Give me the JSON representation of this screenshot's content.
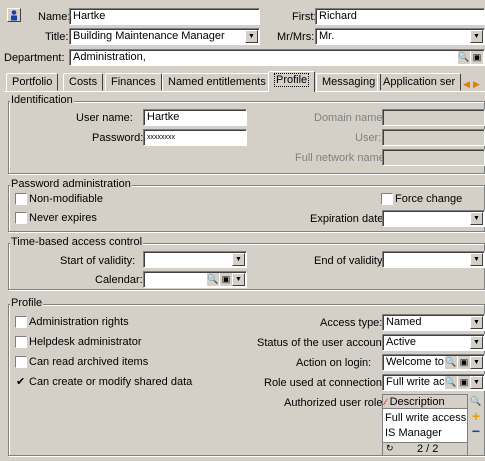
{
  "header": {
    "name_label": "Name:",
    "name_value": "Hartke",
    "first_label": "First:",
    "first_value": "Richard",
    "title_label": "Title:",
    "title_value": "Building Maintenance Manager",
    "mrmrs_label": "Mr/Mrs:",
    "mrmrs_value": "Mr.",
    "department_label": "Department:",
    "department_value": "Administration,"
  },
  "tabs": [
    {
      "label": "Portfolio"
    },
    {
      "label": "Costs"
    },
    {
      "label": "Finances"
    },
    {
      "label": "Named entitlements"
    },
    {
      "label": "Profile"
    },
    {
      "label": "Messaging"
    },
    {
      "label": "Application ser"
    }
  ],
  "identification": {
    "title": "Identification",
    "username_label": "User name:",
    "username_value": "Hartke",
    "password_label": "Password:",
    "password_value": "xxxxxxxx",
    "domain_label": "Domain name:",
    "user_label": "User:",
    "fullnetwork_label": "Full network name:"
  },
  "password_admin": {
    "title": "Password administration",
    "non_modifiable": "Non-modifiable",
    "force_change": "Force change",
    "never_expires": "Never expires",
    "expiration_label": "Expiration date:"
  },
  "time_access": {
    "title": "Time-based access control",
    "start_label": "Start of validity:",
    "end_label": "End of validity:",
    "calendar_label": "Calendar:"
  },
  "profile": {
    "title": "Profile",
    "admin_rights": "Administration rights",
    "helpdesk_admin": "Helpdesk administrator",
    "read_archived": "Can read archived items",
    "create_shared": "Can create or modify shared data",
    "check_mark": "✔",
    "access_type_label": "Access type:",
    "access_type_value": "Named",
    "status_label": "Status of the user account:",
    "status_value": "Active",
    "action_login_label": "Action on login:",
    "action_login_value": "Welcome to A",
    "role_label": "Role used at connection:",
    "role_value": "Full write acc",
    "authorized_roles_label": "Authorized user roles:",
    "roles_header": "Description",
    "roles": [
      "Full write access",
      "IS Manager"
    ],
    "roles_count": "2 / 2"
  }
}
